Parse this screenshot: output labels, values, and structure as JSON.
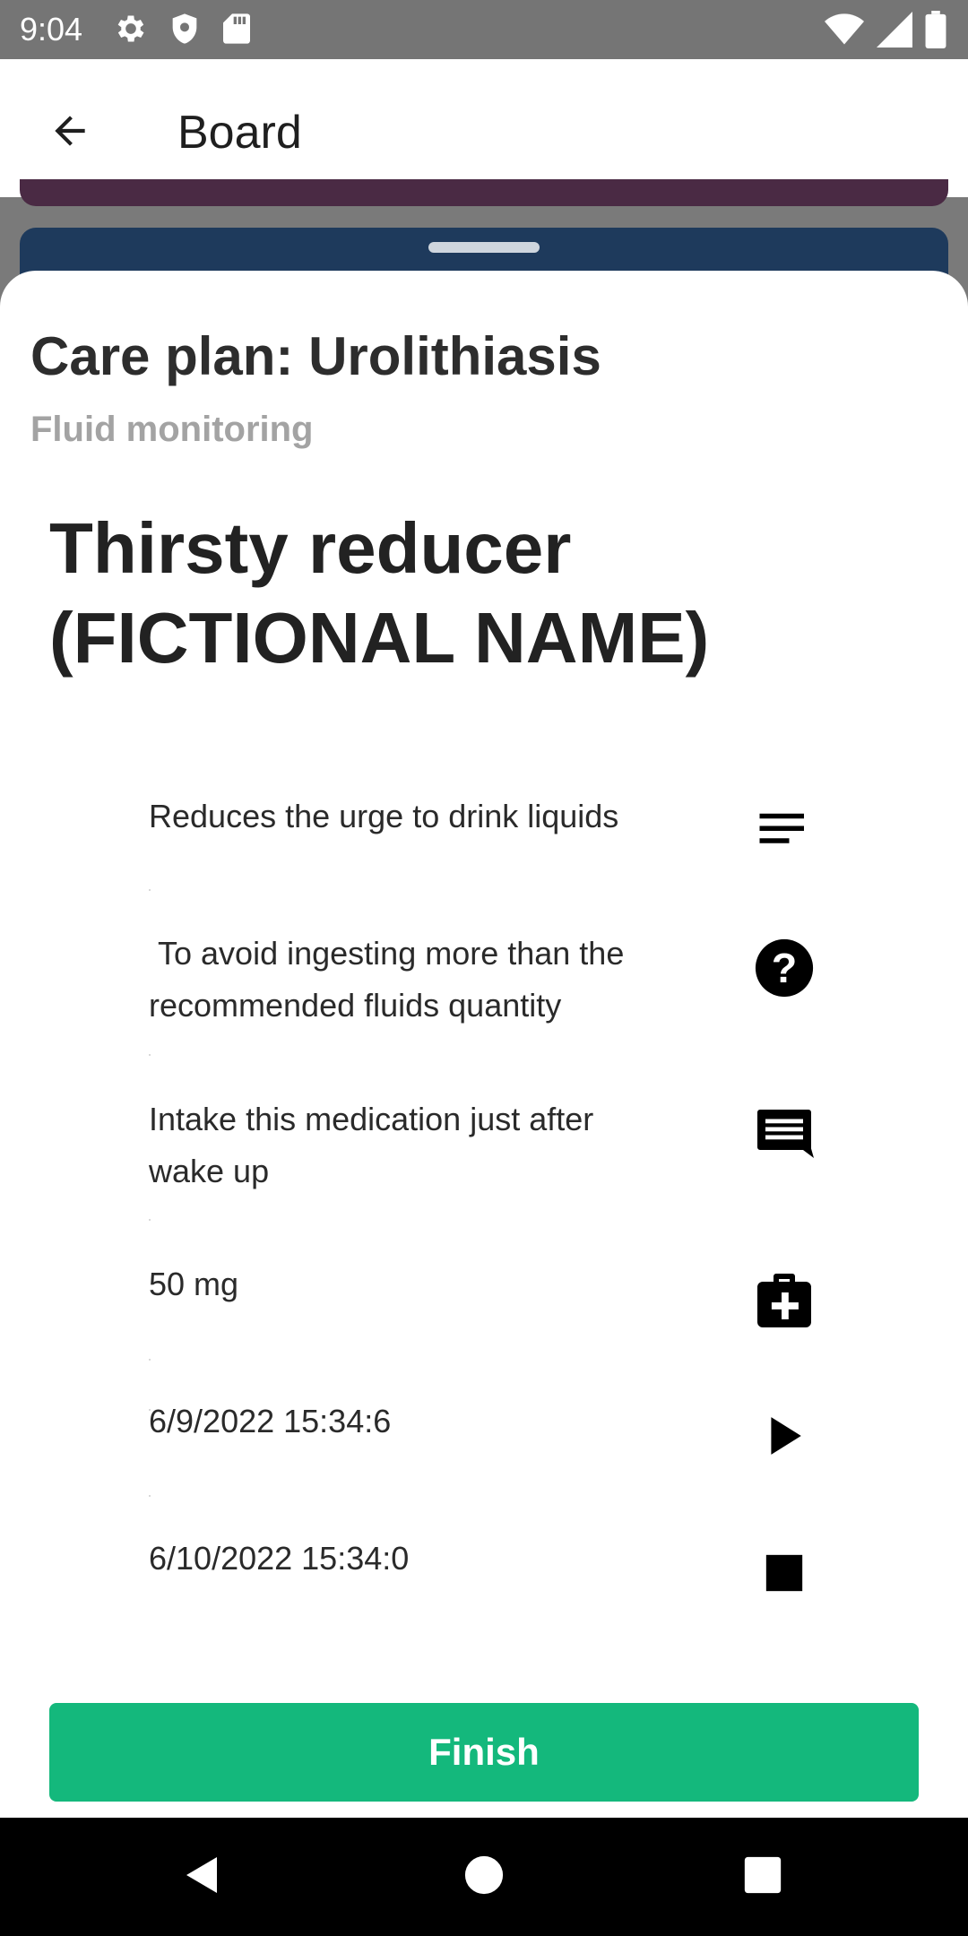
{
  "status_bar": {
    "time": "9:04",
    "left_icons": [
      "gear-icon",
      "shield-icon",
      "sd-card-icon"
    ],
    "right_icons": [
      "wifi-icon",
      "signal-icon",
      "battery-icon"
    ]
  },
  "app_bar": {
    "title": "Board",
    "back_icon": "arrow-back-icon"
  },
  "sheet": {
    "title": "Care plan: Urolithiasis",
    "subtitle": "Fluid monitoring",
    "medication_name": "Thirsty reducer (FICTIONAL NAME)",
    "details": [
      {
        "text": "Reduces the urge to drink liquids",
        "icon": "description-icon"
      },
      {
        "text": " To avoid ingesting more than the recommended fluids quantity",
        "icon": "help-icon"
      },
      {
        "text": "Intake this medication just after wake up",
        "icon": "comment-icon"
      },
      {
        "text": "50 mg",
        "icon": "medical-bag-icon"
      },
      {
        "text": "6/9/2022 15:34:6",
        "icon": "play-icon"
      },
      {
        "text": "6/10/2022 15:34:0",
        "icon": "stop-icon"
      }
    ],
    "finish_label": "Finish"
  },
  "colors": {
    "accent": "#14b87c",
    "status_bar": "#757575",
    "card_dark_blue": "#1e3a5c",
    "card_plum": "#4a2a44"
  },
  "nav_bar": {
    "icons": [
      "nav-back-icon",
      "nav-home-icon",
      "nav-recents-icon"
    ]
  }
}
